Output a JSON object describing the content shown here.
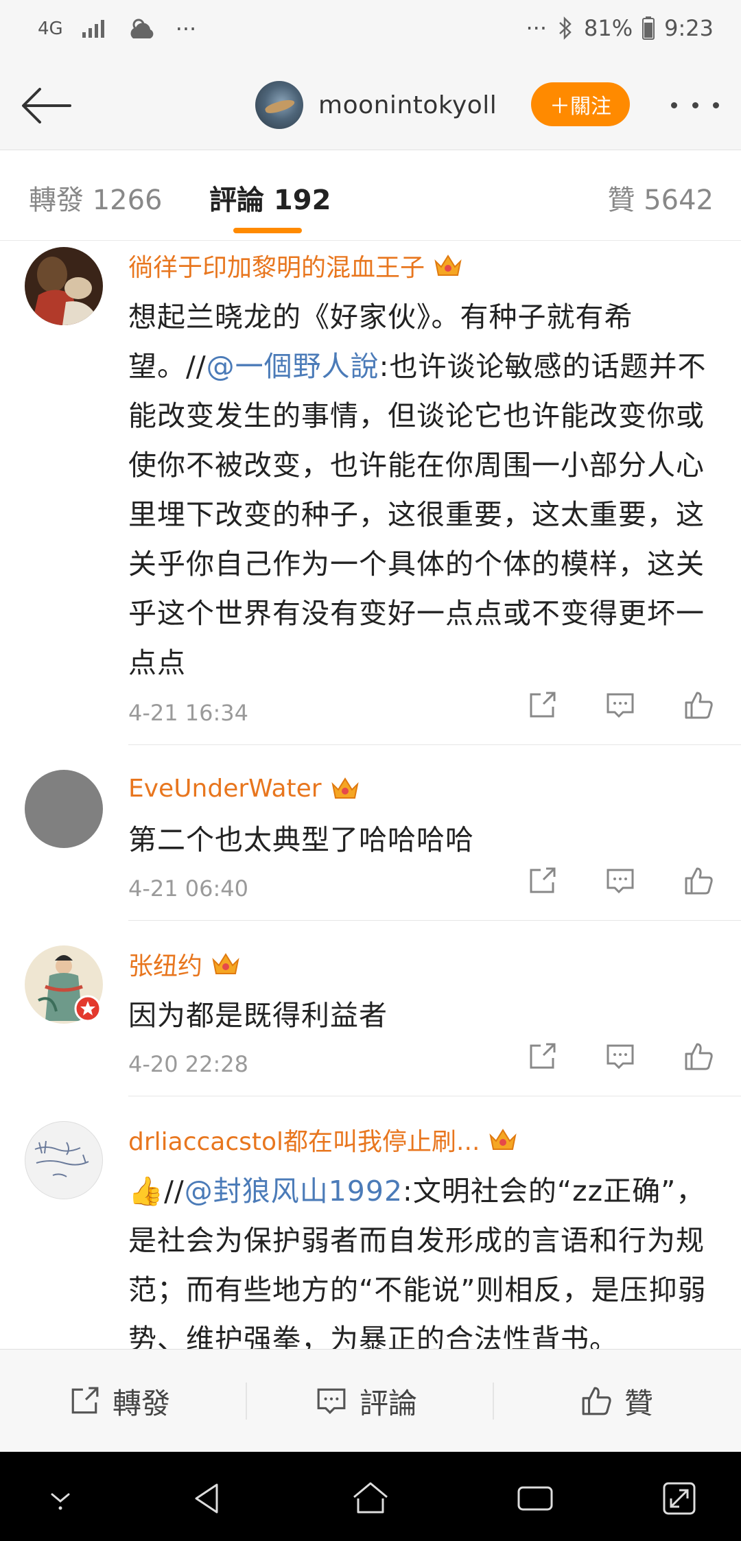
{
  "status_bar": {
    "network": "4G",
    "more": "···",
    "more_right": "···",
    "battery_percent": "81%",
    "time": "9:23"
  },
  "header": {
    "username": "moonintokyoll",
    "follow_label": "＋關注"
  },
  "tabs": {
    "repost": "轉發 1266",
    "comments": "評論 192",
    "likes": "贊 5642"
  },
  "comments": [
    {
      "name": "徜徉于印加黎明的混血王子",
      "text_before": "想起兰晓龙的《好家伙》。有种子就有希望。//",
      "mention": "@一個野人說",
      "text_after": ":也许谈论敏感的话题并不能改变发生的事情，但谈论它也许能改变你或使你不被改变，也许能在你周围一小部分人心里埋下改变的种子，这很重要，这太重要，这关乎你自己作为一个具体的个体的模样，这关乎这个世界有没有变好一点点或不变得更坏一点点",
      "time": "4-21 16:34"
    },
    {
      "name": "EveUnderWater",
      "text": "第二个也太典型了哈哈哈哈",
      "time": "4-21 06:40"
    },
    {
      "name": "张纽约",
      "text": "因为都是既得利益者",
      "time": "4-20 22:28"
    },
    {
      "name": "drliaccacstol都在叫我停止刷...",
      "emoji": "👍",
      "text_before": "//",
      "mention": "@封狼风山1992",
      "text_after": ":文明社会的“zz正确”，是社会为保护弱者而自发形成的言语和行为规范；而有些地方的“不能说”则相反，是压抑弱势、维护强拳，为暴正的合法性背书。"
    }
  ],
  "avatar4_scribble": "我一直都很迫切希望给你们!!!",
  "bottom_bar": {
    "repost": "轉發",
    "comment": "評論",
    "like": "贊"
  },
  "colors": {
    "accent": "#ff8a00",
    "username": "#e8761e",
    "mention": "#4b7bb8",
    "time": "#9a9a9a"
  }
}
